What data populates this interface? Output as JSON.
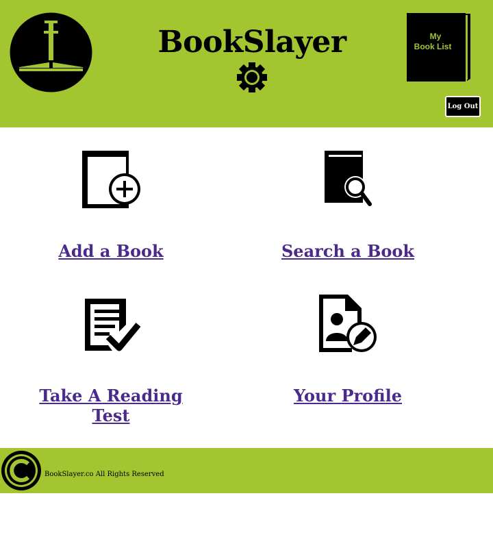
{
  "header": {
    "title": "BookSlayer",
    "my_book_list_line1": "My",
    "my_book_list_line2": "Book List",
    "logout_label": "Log Out"
  },
  "actions": [
    {
      "label": "Add a Book",
      "icon": "add-book-icon"
    },
    {
      "label": "Search a Book",
      "icon": "search-book-icon"
    },
    {
      "label": "Take A Reading Test",
      "icon": "reading-test-icon"
    },
    {
      "label": "Your Profile",
      "icon": "profile-icon"
    }
  ],
  "footer": {
    "copyright_text": "BookSlayer.co All Rights Reserved"
  },
  "colors": {
    "brand_green": "#a2c530",
    "link_purple": "#4b2a8c"
  }
}
